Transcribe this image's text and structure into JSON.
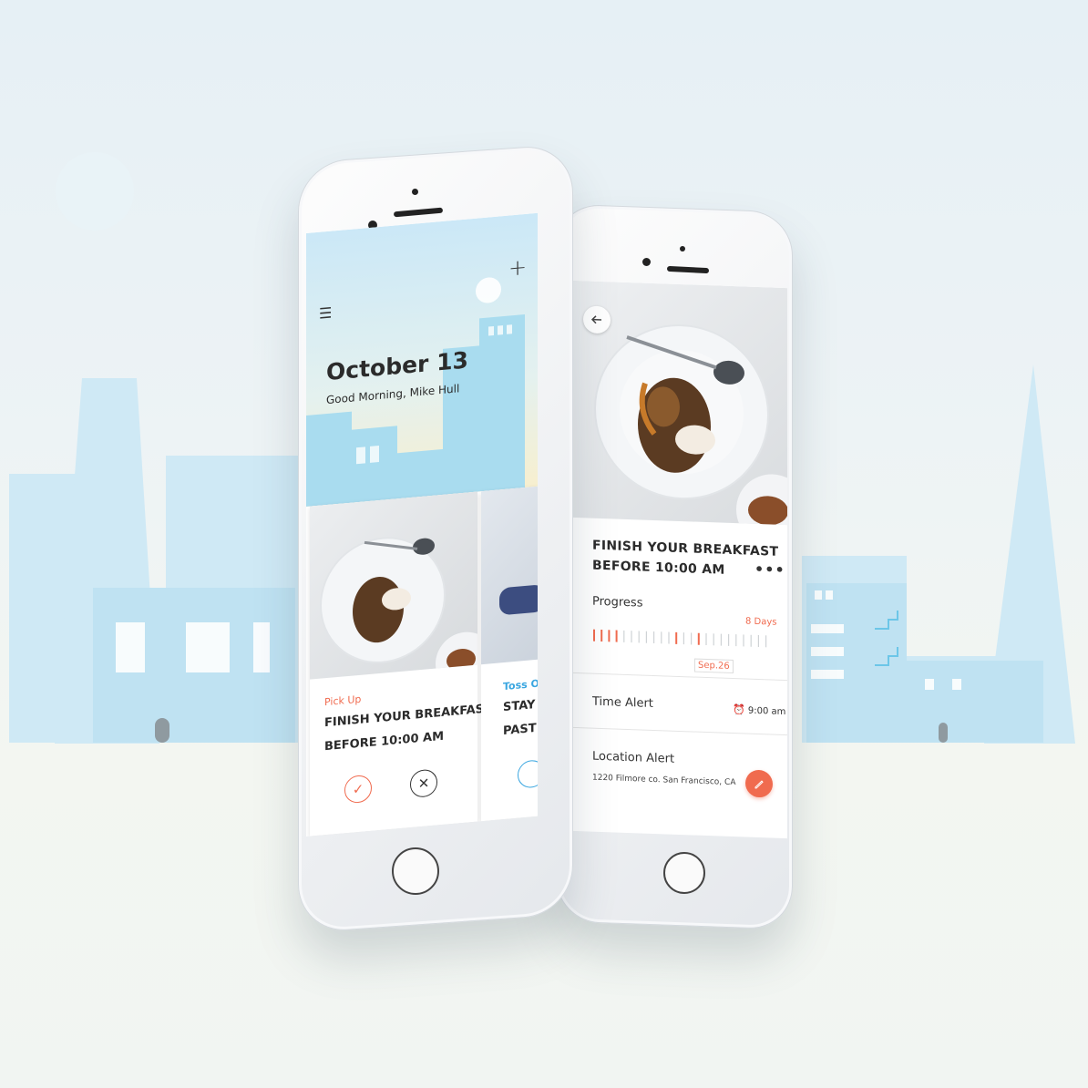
{
  "colors": {
    "accent": "#f06b4f",
    "blue": "#3aa6e0",
    "text": "#2b2b2b",
    "sky": "#cbe8f7",
    "building": "#a9dcef"
  },
  "left_screen": {
    "menu_icon": "hamburger-icon",
    "add_icon": "plus-icon",
    "date": "October 13",
    "greeting": "Good Morning, Mike Hull",
    "cards": [
      {
        "category": "Pick Up",
        "title_line1": "FINISH YOUR  BREAKFAST",
        "title_line2": "BEFORE 10:00 AM",
        "accept_icon": "check-icon",
        "reject_icon": "close-icon"
      },
      {
        "category": "Toss Ou",
        "title_line1": "STAY",
        "title_line2": "PAST"
      }
    ]
  },
  "right_screen": {
    "back_icon": "arrow-left-icon",
    "title_line1": "FINISH YOUR BREAKFAST",
    "title_line2": "BEFORE 10:00 AM",
    "more_icon": "more-dots-icon",
    "progress": {
      "label": "Progress",
      "days": "8 Days",
      "date": "Sep.26"
    },
    "time_alert": {
      "label": "Time Alert",
      "icon": "alarm-clock-icon",
      "value": "9:00 am"
    },
    "location_alert": {
      "label": "Location Alert",
      "address": "1220 Filmore co. San Francisco, CA",
      "edit_icon": "pencil-icon"
    }
  }
}
